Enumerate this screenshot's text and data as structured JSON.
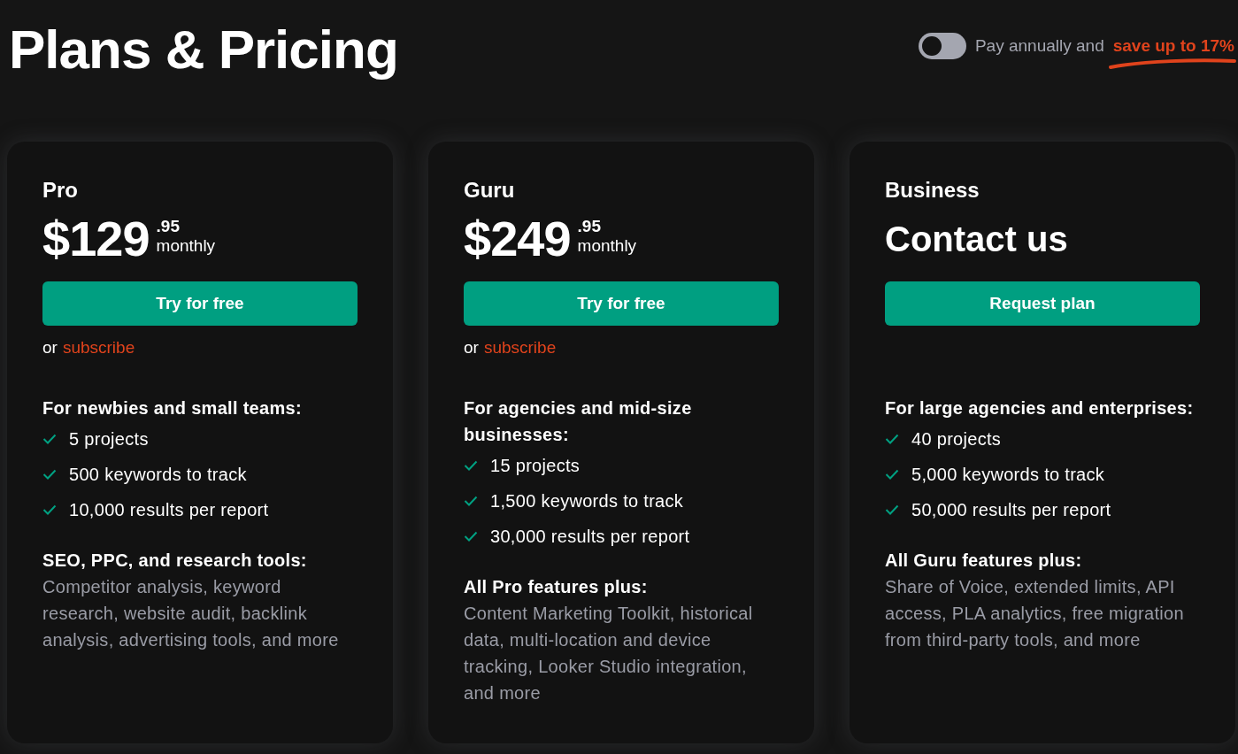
{
  "header": {
    "title": "Plans & Pricing",
    "toggle": {
      "on": false
    },
    "annual_label": "Pay annually and",
    "save_text": "save up to 17%"
  },
  "plans": [
    {
      "name": "Pro",
      "kind": "price",
      "price_main": "$129",
      "price_cents": ".95",
      "period": "monthly",
      "button": "Try for free",
      "alt_prefix": "or",
      "alt_link": "subscribe",
      "audience": "For newbies and small teams:",
      "features": [
        "5 projects",
        "500 keywords to track",
        "10,000 results per report"
      ],
      "extras_title": "SEO, PPC, and research tools:",
      "extras_text": "Competitor analysis, keyword research, website audit, backlink analysis, advertising tools, and more"
    },
    {
      "name": "Guru",
      "kind": "price",
      "price_main": "$249",
      "price_cents": ".95",
      "period": "monthly",
      "button": "Try for free",
      "alt_prefix": "or",
      "alt_link": "subscribe",
      "audience": "For agencies and mid-size businesses:",
      "features": [
        "15 projects",
        "1,500 keywords to track",
        "30,000 results per report"
      ],
      "extras_title": "All Pro features plus:",
      "extras_text": "Content Marketing Toolkit, historical data, multi-location and device tracking, Looker Studio integration, and more"
    },
    {
      "name": "Business",
      "kind": "contact",
      "price_text": "Contact us",
      "button": "Request plan",
      "audience": "For large agencies and enterprises:",
      "features": [
        "40 projects",
        "5,000 keywords to track",
        "50,000 results per report"
      ],
      "extras_title": "All Guru features plus:",
      "extras_text": "Share of Voice, extended limits, API access, PLA analytics, free migration from third-party tools, and more"
    }
  ]
}
